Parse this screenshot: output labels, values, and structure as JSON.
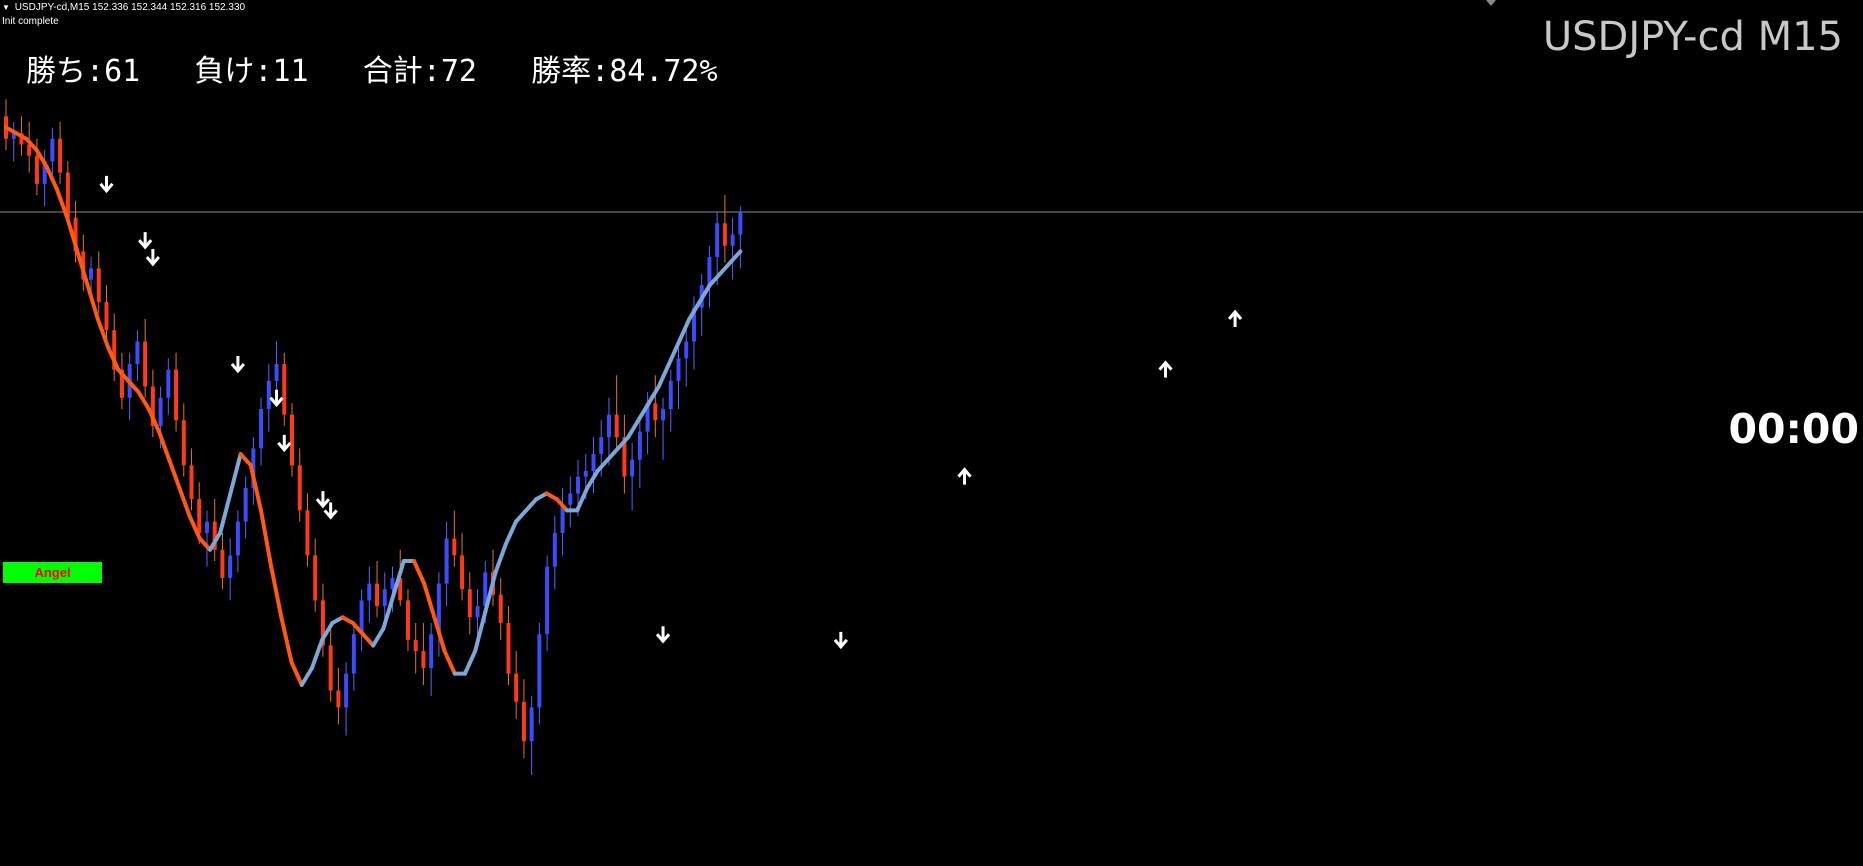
{
  "header": {
    "info_line": "USDJPY-cd,M15  152.336 152.344 152.316 152.330",
    "status": "Init complete"
  },
  "stats": {
    "wins_label": "勝ち",
    "wins": "61",
    "losses_label": "負け",
    "losses": "11",
    "total_label": "合計",
    "total": "72",
    "winrate_label": "勝率",
    "winrate": "84.72%"
  },
  "symbol_title": "USDJPY-cd M15",
  "timer": "00:00",
  "angel_button": "Angel",
  "colors": {
    "background": "#000000",
    "bull_candle": "#3b4cff",
    "bear_candle": "#ff3a1a",
    "wick_bull": "#5566ff",
    "wick_bear": "#e07820",
    "ma_down": "#ff5a10",
    "ma_up": "#7aa8d8",
    "arrow": "#ffffff",
    "price_line": "#8a8a8a",
    "angel_bg": "#00ff00",
    "angel_text": "#ff0000"
  },
  "chart_data": {
    "type": "candlestick",
    "symbol": "USDJPY-cd",
    "timeframe": "M15",
    "last_price": 152.33,
    "candles": [
      [
        152.5,
        152.53,
        152.44,
        152.46
      ],
      [
        152.46,
        152.49,
        152.42,
        152.47
      ],
      [
        152.47,
        152.5,
        152.43,
        152.45
      ],
      [
        152.45,
        152.49,
        152.4,
        152.43
      ],
      [
        152.43,
        152.46,
        152.36,
        152.38
      ],
      [
        152.38,
        152.44,
        152.34,
        152.42
      ],
      [
        152.42,
        152.48,
        152.39,
        152.46
      ],
      [
        152.46,
        152.49,
        152.38,
        152.4
      ],
      [
        152.4,
        152.42,
        152.31,
        152.32
      ],
      [
        152.32,
        152.35,
        152.24,
        152.26
      ],
      [
        152.26,
        152.29,
        152.19,
        152.21
      ],
      [
        152.21,
        152.25,
        152.17,
        152.23
      ],
      [
        152.23,
        152.26,
        152.15,
        152.17
      ],
      [
        152.17,
        152.2,
        152.1,
        152.12
      ],
      [
        152.12,
        152.15,
        152.03,
        152.05
      ],
      [
        152.05,
        152.08,
        151.98,
        152.0
      ],
      [
        152.0,
        152.08,
        151.96,
        152.06
      ],
      [
        152.06,
        152.12,
        152.03,
        152.1
      ],
      [
        152.1,
        152.14,
        152.0,
        152.02
      ],
      [
        152.02,
        152.05,
        151.93,
        151.95
      ],
      [
        151.95,
        152.02,
        151.91,
        152.0
      ],
      [
        152.0,
        152.07,
        151.97,
        152.05
      ],
      [
        152.05,
        152.08,
        151.94,
        151.96
      ],
      [
        151.96,
        151.99,
        151.86,
        151.88
      ],
      [
        151.88,
        151.91,
        151.8,
        151.82
      ],
      [
        151.82,
        151.85,
        151.74,
        151.76
      ],
      [
        151.76,
        151.8,
        151.7,
        151.78
      ],
      [
        151.78,
        151.82,
        151.71,
        151.73
      ],
      [
        151.73,
        151.76,
        151.66,
        151.68
      ],
      [
        151.68,
        151.75,
        151.64,
        151.72
      ],
      [
        151.72,
        151.8,
        151.69,
        151.78
      ],
      [
        151.78,
        151.86,
        151.75,
        151.84
      ],
      [
        151.84,
        151.93,
        151.81,
        151.91
      ],
      [
        151.91,
        152.0,
        151.88,
        151.98
      ],
      [
        151.98,
        152.06,
        151.94,
        152.03
      ],
      [
        152.03,
        152.1,
        151.99,
        152.06
      ],
      [
        152.06,
        152.08,
        151.95,
        151.97
      ],
      [
        151.97,
        151.99,
        151.86,
        151.88
      ],
      [
        151.88,
        151.91,
        151.78,
        151.8
      ],
      [
        151.8,
        151.83,
        151.7,
        151.72
      ],
      [
        151.72,
        151.75,
        151.62,
        151.64
      ],
      [
        151.64,
        151.67,
        151.54,
        151.56
      ],
      [
        151.56,
        151.59,
        151.46,
        151.48
      ],
      [
        151.48,
        151.52,
        151.42,
        151.45
      ],
      [
        151.45,
        151.53,
        151.4,
        151.51
      ],
      [
        151.51,
        151.6,
        151.48,
        151.58
      ],
      [
        151.58,
        151.66,
        151.55,
        151.64
      ],
      [
        151.64,
        151.7,
        151.6,
        151.67
      ],
      [
        151.67,
        151.71,
        151.61,
        151.63
      ],
      [
        151.63,
        151.69,
        151.59,
        151.66
      ],
      [
        151.66,
        151.7,
        151.62,
        151.68
      ],
      [
        151.68,
        151.73,
        151.63,
        151.64
      ],
      [
        151.64,
        151.66,
        151.55,
        151.57
      ],
      [
        151.57,
        151.6,
        151.51,
        151.55
      ],
      [
        151.55,
        151.6,
        151.49,
        151.52
      ],
      [
        151.52,
        151.6,
        151.47,
        151.58
      ],
      [
        151.58,
        151.69,
        151.54,
        151.67
      ],
      [
        151.67,
        151.78,
        151.63,
        151.75
      ],
      [
        151.75,
        151.8,
        151.7,
        151.72
      ],
      [
        151.72,
        151.76,
        151.64,
        151.66
      ],
      [
        151.66,
        151.69,
        151.58,
        151.61
      ],
      [
        151.61,
        151.66,
        151.56,
        151.63
      ],
      [
        151.63,
        151.71,
        151.6,
        151.69
      ],
      [
        151.69,
        151.73,
        151.63,
        151.65
      ],
      [
        151.65,
        151.68,
        151.57,
        151.6
      ],
      [
        151.6,
        151.63,
        151.49,
        151.51
      ],
      [
        151.51,
        151.55,
        151.43,
        151.46
      ],
      [
        151.46,
        151.5,
        151.36,
        151.39
      ],
      [
        151.39,
        151.47,
        151.33,
        151.45
      ],
      [
        151.45,
        151.6,
        151.42,
        151.58
      ],
      [
        151.58,
        151.72,
        151.55,
        151.7
      ],
      [
        151.7,
        151.79,
        151.66,
        151.76
      ],
      [
        151.76,
        151.84,
        151.72,
        151.81
      ],
      [
        151.81,
        151.86,
        151.77,
        151.83
      ],
      [
        151.83,
        151.89,
        151.79,
        151.86
      ],
      [
        151.86,
        151.9,
        151.82,
        151.87
      ],
      [
        151.87,
        151.93,
        151.83,
        151.9
      ],
      [
        151.9,
        151.96,
        151.86,
        151.93
      ],
      [
        151.93,
        152.0,
        151.88,
        151.97
      ],
      [
        151.97,
        152.04,
        151.91,
        151.93
      ],
      [
        151.93,
        151.97,
        151.83,
        151.86
      ],
      [
        151.86,
        151.92,
        151.8,
        151.89
      ],
      [
        151.89,
        151.96,
        151.84,
        151.94
      ],
      [
        151.94,
        152.01,
        151.9,
        151.99
      ],
      [
        151.99,
        152.04,
        151.93,
        151.96
      ],
      [
        151.96,
        152.0,
        151.89,
        151.98
      ],
      [
        151.98,
        152.05,
        151.94,
        152.03
      ],
      [
        152.03,
        152.09,
        151.98,
        152.07
      ],
      [
        152.07,
        152.13,
        152.02,
        152.1
      ],
      [
        152.1,
        152.18,
        152.05,
        152.16
      ],
      [
        152.16,
        152.22,
        152.11,
        152.2
      ],
      [
        152.2,
        152.27,
        152.16,
        152.25
      ],
      [
        152.25,
        152.33,
        152.2,
        152.31
      ],
      [
        152.31,
        152.36,
        152.24,
        152.27
      ],
      [
        152.27,
        152.32,
        152.21,
        152.29
      ],
      [
        152.29,
        152.34,
        152.23,
        152.33
      ]
    ],
    "ma_curve": [
      152.48,
      152.47,
      152.46,
      152.44,
      152.41,
      152.37,
      152.32,
      152.26,
      152.2,
      152.14,
      152.09,
      152.05,
      152.03,
      152.01,
      151.98,
      151.94,
      151.89,
      151.84,
      151.79,
      151.75,
      151.73,
      151.76,
      151.83,
      151.9,
      151.88,
      151.8,
      151.7,
      151.61,
      151.53,
      151.49,
      151.52,
      151.57,
      151.6,
      151.61,
      151.6,
      151.58,
      151.56,
      151.59,
      151.65,
      151.71,
      151.71,
      151.67,
      151.61,
      151.55,
      151.51,
      151.51,
      151.55,
      151.62,
      151.69,
      151.74,
      151.78,
      151.8,
      151.82,
      151.83,
      151.82,
      151.8,
      151.8,
      151.84,
      151.87,
      151.89,
      151.91,
      151.93,
      151.96,
      151.99,
      152.02,
      152.06,
      152.1,
      152.14,
      152.17,
      152.2,
      152.22,
      152.24,
      152.26
    ],
    "signals": [
      {
        "dir": "down",
        "x_index": 13,
        "price": 152.38
      },
      {
        "dir": "down",
        "x_index": 18,
        "price": 152.28
      },
      {
        "dir": "down",
        "x_index": 19,
        "price": 152.25
      },
      {
        "dir": "down",
        "x_index": 30,
        "price": 152.06
      },
      {
        "dir": "down",
        "x_index": 35,
        "price": 152.0
      },
      {
        "dir": "down",
        "x_index": 36,
        "price": 151.92
      },
      {
        "dir": "down",
        "x_index": 41,
        "price": 151.82
      },
      {
        "dir": "down",
        "x_index": 42,
        "price": 151.8
      },
      {
        "dir": "down",
        "x_index": 85,
        "price": 151.58
      },
      {
        "dir": "down",
        "x_index": 108,
        "price": 151.57
      },
      {
        "dir": "up",
        "x_index": 124,
        "price": 151.86
      },
      {
        "dir": "up",
        "x_index": 150,
        "price": 152.05
      },
      {
        "dir": "up",
        "x_index": 159,
        "price": 152.14
      }
    ],
    "ylim": [
      151.25,
      152.6
    ]
  }
}
